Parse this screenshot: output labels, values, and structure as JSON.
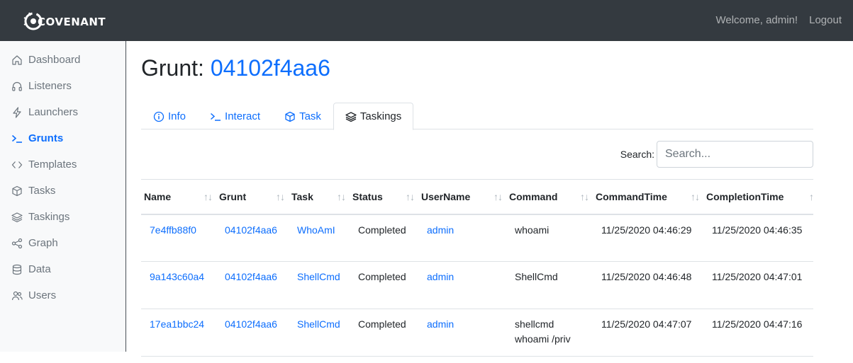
{
  "header": {
    "brand": "COVENANT",
    "welcome": "Welcome, admin!",
    "logout": "Logout"
  },
  "sidebar": {
    "items": [
      {
        "label": "Dashboard",
        "icon": "home-icon"
      },
      {
        "label": "Listeners",
        "icon": "headphones-icon"
      },
      {
        "label": "Launchers",
        "icon": "lightning-icon"
      },
      {
        "label": "Grunts",
        "icon": "terminal-icon",
        "active": true
      },
      {
        "label": "Templates",
        "icon": "code-icon"
      },
      {
        "label": "Tasks",
        "icon": "box-icon"
      },
      {
        "label": "Taskings",
        "icon": "layers-icon"
      },
      {
        "label": "Graph",
        "icon": "share-icon"
      },
      {
        "label": "Data",
        "icon": "database-icon"
      },
      {
        "label": "Users",
        "icon": "users-icon"
      }
    ]
  },
  "page": {
    "title_prefix": "Grunt: ",
    "title_id": "04102f4aa6"
  },
  "tabs": [
    {
      "label": "Info",
      "icon": "info-circle-icon"
    },
    {
      "label": "Interact",
      "icon": "terminal-icon"
    },
    {
      "label": "Task",
      "icon": "box-icon"
    },
    {
      "label": "Taskings",
      "icon": "layers-icon",
      "active": true
    }
  ],
  "search": {
    "label": "Search:",
    "placeholder": "Search..."
  },
  "table": {
    "columns": [
      "Name",
      "Grunt",
      "Task",
      "Status",
      "UserName",
      "Command",
      "CommandTime",
      "CompletionTime"
    ],
    "rows": [
      {
        "name": "7e4ffb88f0",
        "grunt": "04102f4aa6",
        "task": "WhoAmI",
        "status": "Completed",
        "username": "admin",
        "command": "whoami",
        "command_time": "11/25/2020 04:46:29",
        "completion_time": "11/25/2020 04:46:35"
      },
      {
        "name": "9a143c60a4",
        "grunt": "04102f4aa6",
        "task": "ShellCmd",
        "status": "Completed",
        "username": "admin",
        "command": "ShellCmd",
        "command_time": "11/25/2020 04:46:48",
        "completion_time": "11/25/2020 04:47:01"
      },
      {
        "name": "17ea1bbc24",
        "grunt": "04102f4aa6",
        "task": "ShellCmd",
        "status": "Completed",
        "username": "admin",
        "command": "shellcmd whoami /priv",
        "command_time": "11/25/2020 04:47:07",
        "completion_time": "11/25/2020 04:47:16"
      }
    ]
  },
  "colors": {
    "navbar": "#343a40",
    "accent": "#0d6efd",
    "sidebar_bg": "#f8f9fa",
    "muted": "#6c757d"
  }
}
